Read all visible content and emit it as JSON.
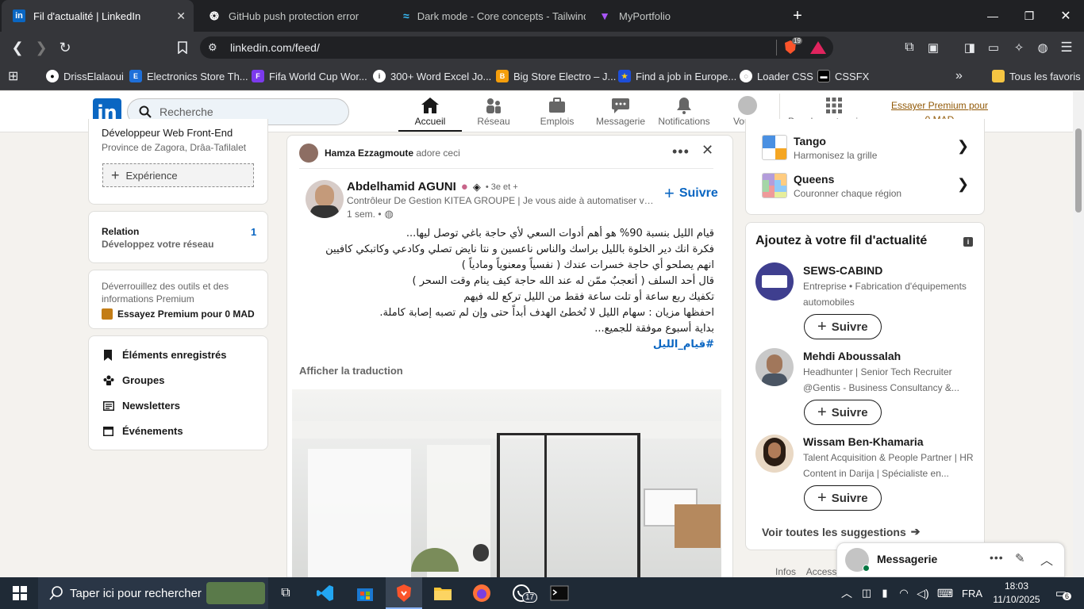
{
  "browser": {
    "tabs": [
      {
        "title": "Fil d'actualité | LinkedIn",
        "icon": "linkedin-icon"
      },
      {
        "title": "GitHub push protection error",
        "icon": "openai-icon"
      },
      {
        "title": "Dark mode - Core concepts - Tailwind",
        "icon": "tailwind-icon"
      },
      {
        "title": "MyPortfolio",
        "icon": "vite-icon"
      }
    ],
    "url": "linkedin.com/feed/",
    "brave_badge": "19",
    "bookmarks": [
      "DrissElalaoui",
      "Electronics Store Th...",
      "Fifa World Cup Wor...",
      "300+ Word Excel Jo...",
      "Big Store Electro – J...",
      "Find a job in Europe...",
      "Loader CSS",
      "CSSFX"
    ],
    "all_bookmarks": "Tous les favoris"
  },
  "nav": {
    "search_placeholder": "Recherche",
    "items": [
      "Accueil",
      "Réseau",
      "Emplois",
      "Messagerie",
      "Notifications",
      "Vous",
      "Pour les entreprises"
    ],
    "premium": "Essayer Premium pour 0 MAD"
  },
  "left": {
    "profile_title": "Développeur Web Front-End",
    "location": "Province de Zagora, Drâa-Tafilalet",
    "experience_btn": "Expérience",
    "relation_title": "Relation",
    "relation_sub": "Développez votre réseau",
    "relation_count": "1",
    "premium_text": "Déverrouillez des outils et des informations Premium",
    "premium_cta": "Essayez Premium pour 0 MAD",
    "links": [
      "Éléments enregistrés",
      "Groupes",
      "Newsletters",
      "Événements"
    ]
  },
  "post": {
    "liker_name": "Hamza Ezzagmoute",
    "liker_action": "adore ceci",
    "author_name": "Abdelhamid AGUNI",
    "degree": "• 3e et +",
    "headline": "Contrôleur De Gestion KITEA GROUPE | Je vous aide à automatiser votre...",
    "time": "1 sem. •",
    "follow": "Suivre",
    "lines": [
      "قيام الليل بنسبة 90% هو أهم أدوات السعي لأي حاجة باغي توصل ليها...",
      "فكرة انك دير الخلوة بالليل براسك والناس ناعسين و نتا نايض تصلي وكادعي وكاتبكي كافيين",
      "انهم يصلحو أي حاجة خسرات عندك ( نفسياً ومعنوياً ومادياً )",
      "قال أحد السلف ( أتعجبٌ ممّن له عند الله حاجة كيف ينام وقت السحر )",
      "تكفيك ربع ساعة أو تلت ساعة فقط من الليل تركع لله فيهم",
      "احفظها مزيان : سهام الليل لا تُخطئ الهدف أبداً حتى وإن لم تصبه إصابة كاملة.",
      "بداية أسبوع موفقة للجميع..."
    ],
    "hashtag": "#قيام_الليل",
    "translate": "Afficher la traduction"
  },
  "right": {
    "games": [
      {
        "name": "Tango",
        "sub": "Harmonisez la grille"
      },
      {
        "name": "Queens",
        "sub": "Couronner chaque région"
      }
    ],
    "feed_title": "Ajoutez à votre fil d'actualité",
    "suggestions": [
      {
        "name": "SEWS-CABIND",
        "sub1": "Entreprise • Fabrication d'équipements",
        "sub2": "automobiles"
      },
      {
        "name": "Mehdi Aboussalah",
        "sub1": "Headhunter | Senior Tech Recruiter",
        "sub2": "@Gentis - Business Consultancy &..."
      },
      {
        "name": "Wissam Ben-Khamaria",
        "sub1": "Talent Acquisition & People Partner | HR",
        "sub2": "Content in Darija | Spécialiste en..."
      }
    ],
    "follow": "Suivre",
    "see_all": "Voir toutes les suggestions",
    "footer": "Infos    Access",
    "messaging": "Messagerie"
  },
  "taskbar": {
    "search": "Taper ici pour rechercher",
    "whatsapp_badge": "17",
    "lang": "FRA",
    "time": "18:03",
    "date": "11/10/2025",
    "notif": "6"
  }
}
